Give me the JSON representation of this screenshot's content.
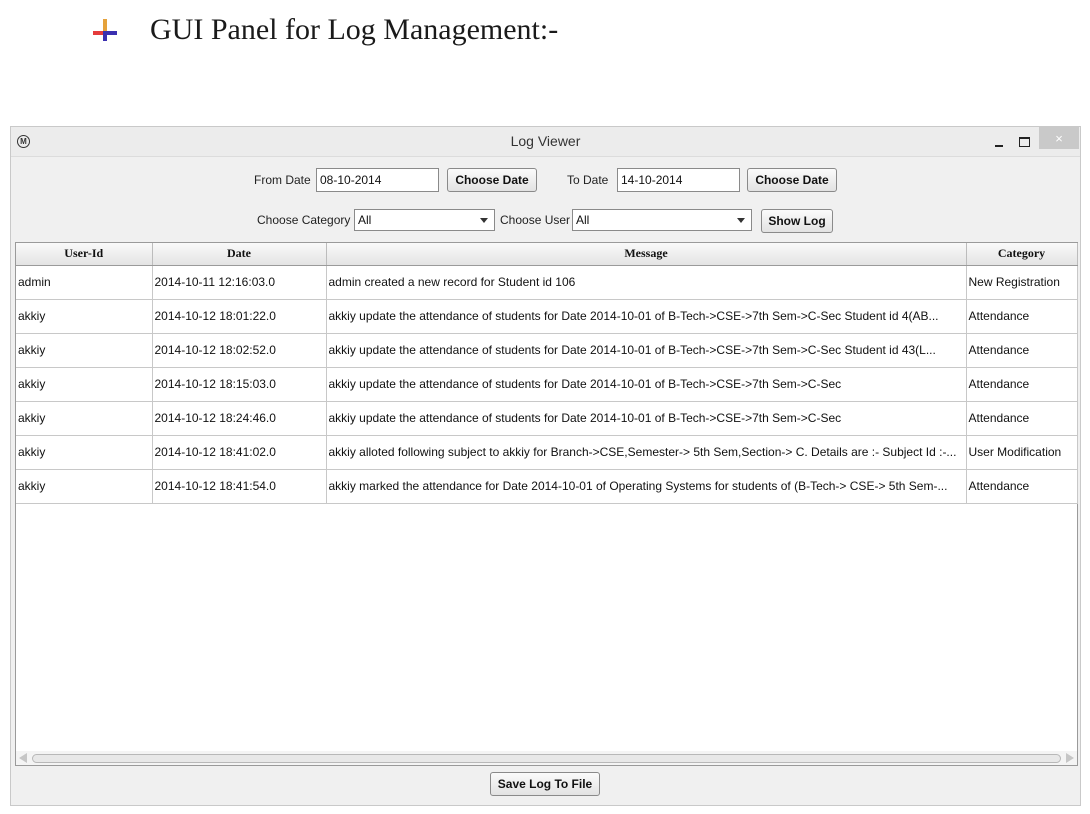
{
  "document": {
    "heading": "GUI Panel for Log Management:-"
  },
  "window": {
    "title": "Log Viewer",
    "app_icon": "M",
    "close_glyph": "×"
  },
  "filters": {
    "from_date_label": "From Date",
    "from_date_value": "08-10-2014",
    "choose_date_label": "Choose Date",
    "to_date_label": "To Date",
    "to_date_value": "14-10-2014",
    "choose_category_label": "Choose Category",
    "category_value": "All",
    "choose_user_label": "Choose User",
    "user_value": "All",
    "show_log_label": "Show Log"
  },
  "table": {
    "columns": [
      "User-Id",
      "Date",
      "Message",
      "Category"
    ],
    "rows": [
      [
        "admin",
        "2014-10-11 12:16:03.0",
        "admin created a new record for Student id 106",
        "New Registration"
      ],
      [
        "akkiy",
        "2014-10-12 18:01:22.0",
        "akkiy update the attendance of students  for Date 2014-10-01 of B-Tech->CSE->7th Sem->C-Sec Student id  4(AB...",
        "Attendance"
      ],
      [
        "akkiy",
        "2014-10-12 18:02:52.0",
        "akkiy update the attendance of students  for Date 2014-10-01 of B-Tech->CSE->7th Sem->C-Sec Student id  43(L...",
        "Attendance"
      ],
      [
        "akkiy",
        "2014-10-12 18:15:03.0",
        "akkiy update the attendance of students  for Date 2014-10-01 of B-Tech->CSE->7th Sem->C-Sec",
        "Attendance"
      ],
      [
        "akkiy",
        "2014-10-12 18:24:46.0",
        "akkiy update the attendance of students  for Date 2014-10-01 of B-Tech->CSE->7th Sem->C-Sec",
        "Attendance"
      ],
      [
        "akkiy",
        "2014-10-12 18:41:02.0",
        "akkiy alloted following subject to akkiy for Branch->CSE,Semester-> 5th Sem,Section-> C. Details are :- Subject Id :-...",
        "User Modification"
      ],
      [
        "akkiy",
        "2014-10-12 18:41:54.0",
        "akkiy marked the attendance for Date 2014-10-01 of Operating Systems for students of (B-Tech-> CSE-> 5th Sem-...",
        "Attendance"
      ]
    ]
  },
  "footer": {
    "save_label": "Save Log To File"
  }
}
